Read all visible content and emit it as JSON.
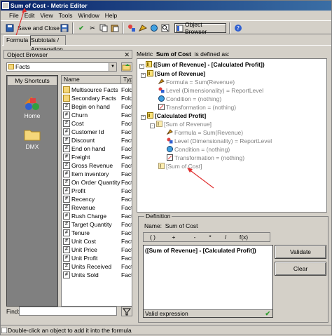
{
  "window": {
    "title": "Sum of Cost - Metric Editor"
  },
  "menu": [
    "File",
    "Edit",
    "View",
    "Tools",
    "Window",
    "Help"
  ],
  "toolbar": {
    "save_close": "Save and Close",
    "object_browser": "Object Browser"
  },
  "tabs": [
    "Formula",
    "Subtotals / Aggregation"
  ],
  "object_browser": {
    "title": "Object Browser",
    "folder": "Facts",
    "shortcuts_header": "My Shortcuts",
    "shortcuts": [
      {
        "label": "Home"
      },
      {
        "label": "DMX"
      }
    ],
    "columns": [
      "Name",
      "Type"
    ],
    "items": [
      {
        "name": "Multisource Facts",
        "type": "Fold",
        "kind": "folder"
      },
      {
        "name": "Secondary Facts",
        "type": "Fold",
        "kind": "folder"
      },
      {
        "name": "Begin on hand",
        "type": "Fact",
        "kind": "fact"
      },
      {
        "name": "Churn",
        "type": "Fact",
        "kind": "fact"
      },
      {
        "name": "Cost",
        "type": "Fact",
        "kind": "fact"
      },
      {
        "name": "Customer Id",
        "type": "Fact",
        "kind": "fact"
      },
      {
        "name": "Discount",
        "type": "Fact",
        "kind": "fact"
      },
      {
        "name": "End on hand",
        "type": "Fact",
        "kind": "fact"
      },
      {
        "name": "Freight",
        "type": "Fact",
        "kind": "fact"
      },
      {
        "name": "Gross Revenue",
        "type": "Fact",
        "kind": "fact"
      },
      {
        "name": "Item inventory",
        "type": "Fact",
        "kind": "fact"
      },
      {
        "name": "On Order Quantity",
        "type": "Fact",
        "kind": "fact"
      },
      {
        "name": "Profit",
        "type": "Fact",
        "kind": "fact"
      },
      {
        "name": "Recency",
        "type": "Fact",
        "kind": "fact"
      },
      {
        "name": "Revenue",
        "type": "Fact",
        "kind": "fact"
      },
      {
        "name": "Rush Charge",
        "type": "Fact",
        "kind": "fact"
      },
      {
        "name": "Target Quantity",
        "type": "Fact",
        "kind": "fact"
      },
      {
        "name": "Tenure",
        "type": "Fact",
        "kind": "fact"
      },
      {
        "name": "Unit Cost",
        "type": "Fact",
        "kind": "fact"
      },
      {
        "name": "Unit Price",
        "type": "Fact",
        "kind": "fact"
      },
      {
        "name": "Unit Profit",
        "type": "Fact",
        "kind": "fact"
      },
      {
        "name": "Units Received",
        "type": "Fact",
        "kind": "fact"
      },
      {
        "name": "Units Sold",
        "type": "Fact",
        "kind": "fact"
      }
    ],
    "find_label": "Find:"
  },
  "metric": {
    "prefix": "Metric",
    "name": "Sum of Cost",
    "suffix": "is defined as:"
  },
  "tree": [
    {
      "text": "([Sum of Revenue] - [Calculated Profit])",
      "style": "bold"
    },
    {
      "text": "[Sum of Revenue]",
      "style": "bold"
    },
    {
      "text": "Formula = Sum(Revenue)",
      "style": "grey"
    },
    {
      "text": "Level (Dimensionality) = ReportLevel",
      "style": "grey"
    },
    {
      "text": "Condition = (nothing)",
      "style": "grey"
    },
    {
      "text": "Transformation = (nothing)",
      "style": "grey"
    },
    {
      "text": "[Calculated Profit]",
      "style": "bold"
    },
    {
      "text": "[Sum of Revenue]",
      "style": "grey"
    },
    {
      "text": "Formula = Sum(Revenue)",
      "style": "grey"
    },
    {
      "text": "Level (Dimensionality) = ReportLevel",
      "style": "grey"
    },
    {
      "text": "Condition = (nothing)",
      "style": "grey"
    },
    {
      "text": "Transformation = (nothing)",
      "style": "grey"
    },
    {
      "text": "[Sum of Cost]",
      "style": "grey"
    }
  ],
  "definition": {
    "legend": "Definition",
    "name_label": "Name:",
    "name_value": "Sum of Cost",
    "operators": [
      "( )",
      "+",
      "-",
      "*",
      "/",
      "f(x)"
    ],
    "formula": "([Sum of Revenue] - [Calculated Profit])",
    "status": "Valid expression",
    "validate": "Validate",
    "clear": "Clear"
  },
  "status_bar": "Double-click an object to add it into the formula",
  "colors": {
    "title_start": "#0a246a",
    "title_end": "#3a6ea5",
    "arrow": "#e03030",
    "valid_check": "#2a9a2a"
  }
}
